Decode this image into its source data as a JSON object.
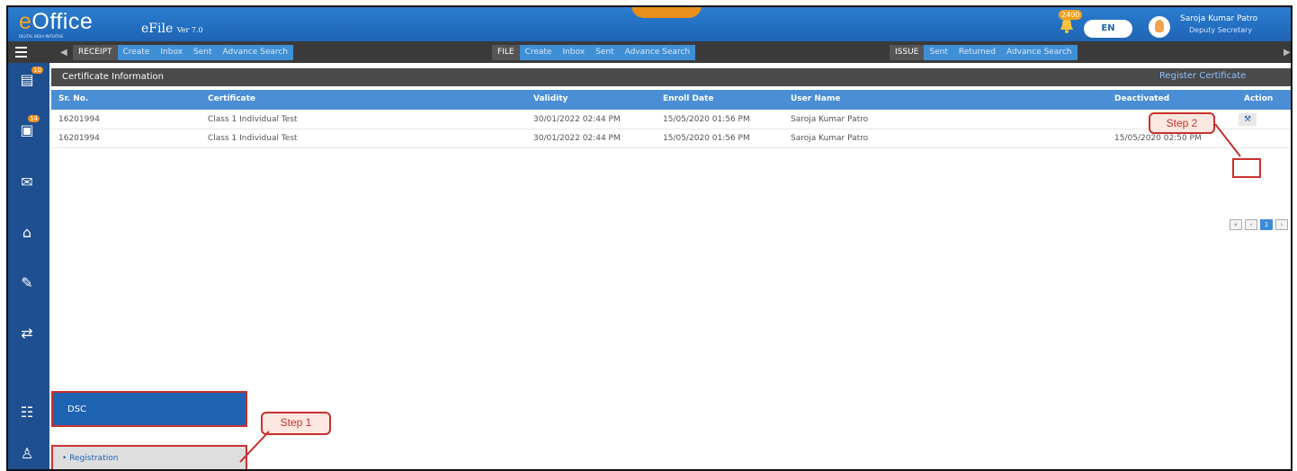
{
  "header": {
    "logo": "Office",
    "logo_prefix": "e",
    "logo_subtitle": "DIGITAL INDIA INITIATIVE",
    "app_name": "eFile",
    "version": "Ver 7.0",
    "notification_count": "2400",
    "language": "EN",
    "user_name": "Saroja Kumar Patro",
    "user_designation": "Deputy Secretary"
  },
  "menubar": {
    "receipt_label": "RECEIPT",
    "receipt_links": [
      "Create",
      "Inbox",
      "Sent",
      "Advance Search"
    ],
    "file_label": "FILE",
    "file_links": [
      "Create",
      "Inbox",
      "Sent",
      "Advance Search"
    ],
    "issue_label": "ISSUE",
    "issue_links": [
      "Sent",
      "Returned",
      "Advance Search"
    ]
  },
  "sidebar": {
    "badges": [
      "10",
      "14"
    ],
    "icons": [
      "receipt-icon",
      "file-icon",
      "mail-icon",
      "home-icon",
      "edit-icon",
      "transfer-icon",
      "dsc-icon",
      "user-icon"
    ]
  },
  "section": {
    "title": "Certificate Information",
    "link": "Register Certificate"
  },
  "table": {
    "headers": [
      "Sr. No.",
      "Certificate",
      "Validity",
      "Enroll Date",
      "User Name",
      "Deactivated",
      "Action"
    ],
    "rows": [
      {
        "srno": "16201994",
        "certificate": "Class 1 Individual Test",
        "validity": "30/01/2022 02:44 PM",
        "enroll": "15/05/2020 01:56 PM",
        "user": "Saroja Kumar Patro",
        "deactivated": "",
        "action": "⚒"
      },
      {
        "srno": "16201994",
        "certificate": "Class 1 Individual Test",
        "validity": "30/01/2022 02:44 PM",
        "enroll": "15/05/2020 01:56 PM",
        "user": "Saroja Kumar Patro",
        "deactivated": "15/05/2020 02:50 PM",
        "action": ""
      }
    ]
  },
  "pager": {
    "pages": [
      "«",
      "‹",
      "1",
      "›",
      "»"
    ]
  },
  "flyout": {
    "dsc": "DSC",
    "registration": "• Registration"
  },
  "callouts": {
    "step1": "Step 1",
    "step2": "Step 2"
  },
  "colors": {
    "header": "#1e64b4",
    "accent": "#3f8fd6",
    "highlight": "#c8312e"
  }
}
